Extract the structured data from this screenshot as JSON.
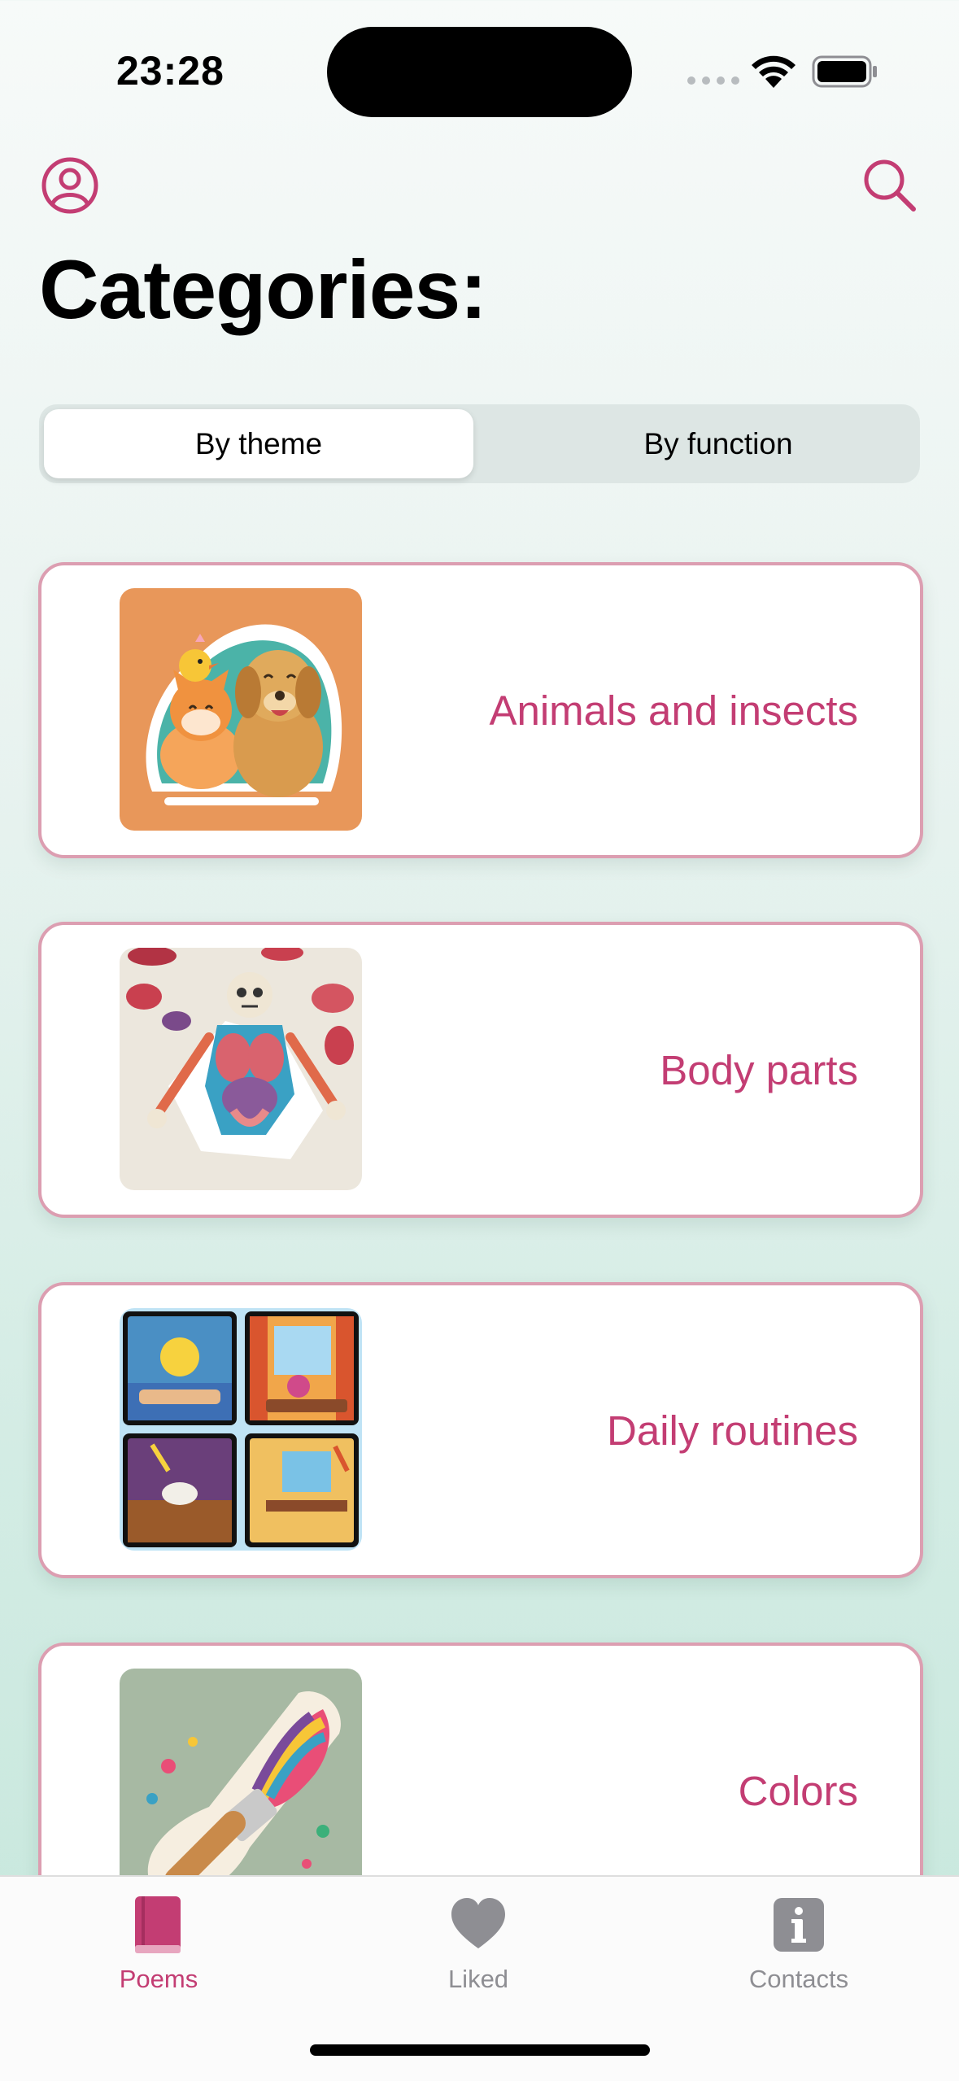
{
  "status_bar": {
    "time": "23:28"
  },
  "header": {
    "title": "Categories:",
    "profile_icon": "person-circle-icon",
    "search_icon": "search-icon"
  },
  "segmented_control": {
    "options": [
      "By theme",
      "By function"
    ],
    "selected": "By theme"
  },
  "categories": [
    {
      "label": "Animals and insects",
      "image": "animals-sticker-image"
    },
    {
      "label": "Body parts",
      "image": "body-anatomy-sticker-image"
    },
    {
      "label": "Daily routines",
      "image": "daily-routine-collage-image"
    },
    {
      "label": "Colors",
      "image": "paintbrush-sticker-image"
    }
  ],
  "tab_bar": {
    "tabs": [
      {
        "label": "Poems",
        "icon": "book-icon",
        "active": true
      },
      {
        "label": "Liked",
        "icon": "heart-icon",
        "active": false
      },
      {
        "label": "Contacts",
        "icon": "info-icon",
        "active": false
      }
    ]
  },
  "colors": {
    "accent": "#c33d73",
    "card_border": "#dc9eb1",
    "inactive_tab": "#8e8e93"
  }
}
